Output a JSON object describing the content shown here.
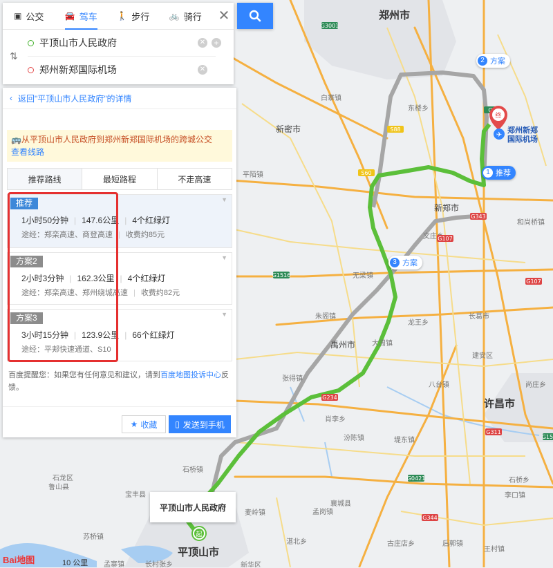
{
  "modes": [
    {
      "label": "公交",
      "icon": "bus-icon"
    },
    {
      "label": "驾车",
      "icon": "car-icon",
      "active": true
    },
    {
      "label": "步行",
      "icon": "walk-icon"
    },
    {
      "label": "骑行",
      "icon": "bike-icon"
    }
  ],
  "route": {
    "start": "平顶山市人民政府",
    "end": "郑州新郑国际机场"
  },
  "back_link": "返回\"平顶山市人民政府\"的详情",
  "transit_notice": {
    "text": "从平顶山市人民政府到郑州新郑国际机场的跨城公交",
    "link": "查看线路"
  },
  "tabs": [
    "推荐路线",
    "最短路程",
    "不走高速"
  ],
  "plans": [
    {
      "badge": "推荐",
      "duration": "1小时50分钟",
      "distance": "147.6公里",
      "lights": "4个红绿灯",
      "via": "途经：郑栾高速、商登高速",
      "toll": "收费约85元"
    },
    {
      "badge": "方案2",
      "duration": "2小时3分钟",
      "distance": "162.3公里",
      "lights": "4个红绿灯",
      "via": "途经：郑栾高速、郑州绕城高速",
      "toll": "收费约82元"
    },
    {
      "badge": "方案3",
      "duration": "3小时15分钟",
      "distance": "123.9公里",
      "lights": "66个红绿灯",
      "via": "途经：平郏快速通道、S10",
      "toll": ""
    }
  ],
  "tip": {
    "prefix": "百度提醒您：如果您有任何意见和建议，请到",
    "link": "百度地图投诉中心",
    "suffix": "反馈。"
  },
  "actions": {
    "favorite": "收藏",
    "send": "发送到手机"
  },
  "map": {
    "markers": {
      "recommended": {
        "num": "1",
        "label": "推荐"
      },
      "plan2": {
        "num": "2",
        "label": "方案"
      },
      "plan3": {
        "num": "3",
        "label": "方案"
      },
      "start_badge": "起",
      "end_badge": "终"
    },
    "start_popup": "平顶山市人民政府",
    "dest_label_line1": "郑州新郑",
    "dest_label_line2": "国际机场",
    "cities": {
      "zhengzhou": "郑州市",
      "xuchang": "许昌市",
      "pingdingshan": "平顶山市",
      "yuzhou": "禹州市",
      "xinzheng": "新郑市",
      "xinmi": "新密市"
    },
    "towns": [
      "白寨镇",
      "平陌镇",
      "无梁镇",
      "朱阁镇",
      "张得镇",
      "汾陈镇",
      "长葛市",
      "建安区",
      "石龙区",
      "宝丰县",
      "石桥镇",
      "襄城县",
      "麦岭镇",
      "孟岗镇",
      "湛北乡",
      "新华区",
      "鲁山县",
      "石桥乡",
      "尚庄乡",
      "东楼乡",
      "和尚桥镇",
      "肖李乡",
      "大周镇",
      "龙王乡",
      "文庄乡",
      "古庄店乡",
      "后郭镇",
      "王村镇",
      "李口镇",
      "苏桥镇",
      "孟寨镇",
      "长村张乡",
      "八台镇",
      "堤东镇"
    ],
    "road_shields": [
      "G3001",
      "G4",
      "S88",
      "S60",
      "G343",
      "G107",
      "G1516",
      "G234",
      "G311",
      "G0421",
      "G344"
    ],
    "scale": "10 公里",
    "logo": "Bai地图"
  },
  "colors": {
    "accent": "#3385ff",
    "route_main": "#5bbf3a",
    "route_alt": "#a6a6a6",
    "highlight": "#e53030"
  }
}
